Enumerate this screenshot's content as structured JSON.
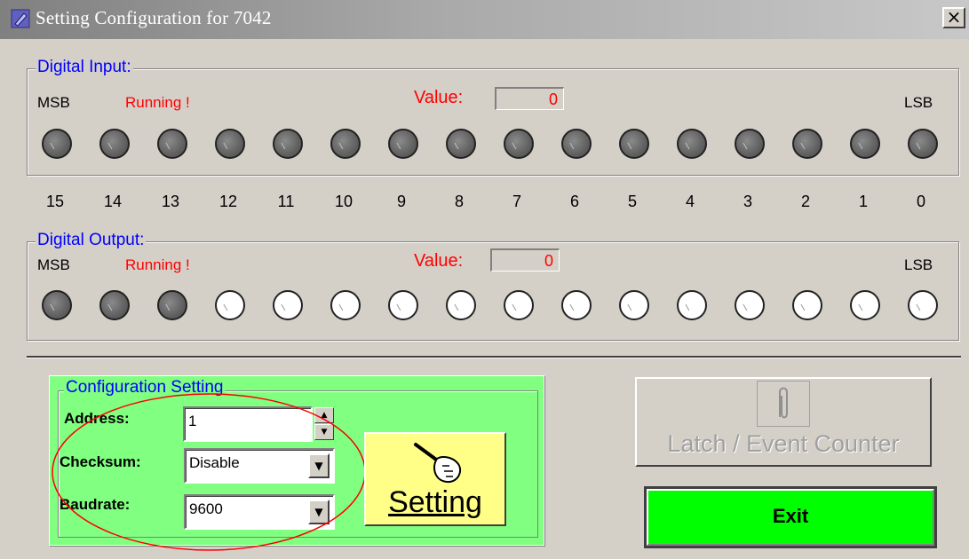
{
  "window": {
    "title": "Setting Configuration for 7042",
    "close_label": "×"
  },
  "digital_input": {
    "title": "Digital Input:",
    "msb": "MSB",
    "lsb": "LSB",
    "status": "Running !",
    "value_label": "Value:",
    "value": "0",
    "leds": [
      "off",
      "off",
      "off",
      "off",
      "off",
      "off",
      "off",
      "off",
      "off",
      "off",
      "off",
      "off",
      "off",
      "off",
      "off",
      "off"
    ]
  },
  "bit_numbers": [
    "15",
    "14",
    "13",
    "12",
    "11",
    "10",
    "9",
    "8",
    "7",
    "6",
    "5",
    "4",
    "3",
    "2",
    "1",
    "0"
  ],
  "digital_output": {
    "title": "Digital Output:",
    "msb": "MSB",
    "lsb": "LSB",
    "status": "Running !",
    "value_label": "Value:",
    "value": "0",
    "leds": [
      "off",
      "off",
      "off",
      "on",
      "on",
      "on",
      "on",
      "on",
      "on",
      "on",
      "on",
      "on",
      "on",
      "on",
      "on",
      "on"
    ]
  },
  "config": {
    "title": "Configuration Setting",
    "address_label": "Address:",
    "address_value": "1",
    "checksum_label": "Checksum:",
    "checksum_value": "Disable",
    "baudrate_label": "Baudrate:",
    "baudrate_value": "9600",
    "highlight_color": "#ff0000"
  },
  "buttons": {
    "setting_label": "Setting",
    "latch_label": "Latch / Event Counter",
    "exit_label": "Exit"
  },
  "colors": {
    "config_panel": "#80ff80",
    "setting_button": "#ffff88",
    "exit_button": "#00ff00",
    "group_title": "#0000ff",
    "status_text": "#ff0000"
  }
}
